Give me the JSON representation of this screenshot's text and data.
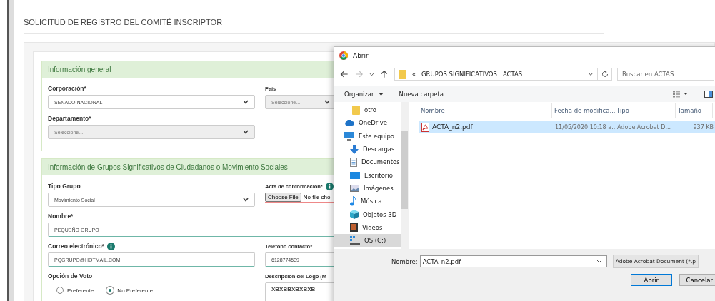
{
  "page": {
    "title": "SOLICITUD DE REGISTRO DEL COMITÉ INSCRIPTOR"
  },
  "sections": [
    {
      "title": "Información general",
      "rows": [
        [
          {
            "kind": "select",
            "label": "Corporación*",
            "value": "SENADO NACIONAL",
            "disabled": false
          },
          {
            "kind": "select",
            "label": "País",
            "placeholder": "Seleccione...",
            "disabled": true
          }
        ],
        [
          {
            "kind": "select",
            "label": "Departamento*",
            "placeholder": "Seleccione...",
            "disabled": true
          }
        ]
      ]
    },
    {
      "title": "Información de Grupos Significativos de Ciudadanos o Movimiento Sociales",
      "rows": [
        [
          {
            "kind": "select",
            "label": "Tipo Grupo",
            "value": "Movimiento Social",
            "disabled": false
          },
          {
            "kind": "file",
            "label": "Acta de conformación*",
            "info": true,
            "button": "Choose File",
            "status": "No file cho"
          }
        ],
        [
          {
            "kind": "wide-text",
            "label": "Nombre*",
            "value": "PEQUEÑO GRUPO"
          }
        ],
        [
          {
            "kind": "text",
            "label": "Correo electrónico*",
            "info": true,
            "value": "PQGRUPO@HOTMAIL.COM"
          },
          {
            "kind": "text",
            "label": "Teléfono contacto*",
            "value": "6128774539"
          }
        ],
        [
          {
            "kind": "radio",
            "label": "Opción de Voto",
            "options": [
              {
                "label": "Preferente",
                "selected": false
              },
              {
                "label": "No Preferente",
                "selected": true
              }
            ]
          },
          {
            "kind": "textarea",
            "label": "Descripción del Logo (M",
            "value": "XBXBBXBXBXB"
          }
        ]
      ]
    }
  ],
  "dialog": {
    "title": "Abrir",
    "path": [
      "«",
      "GRUPOS SIGNIFICATIVOS",
      "ACTAS"
    ],
    "search": {
      "placeholder": "Buscar en ACTAS"
    },
    "toolbar": [
      {
        "label": "Organizar",
        "dropdown": true
      },
      {
        "label": "Nueva carpeta",
        "dropdown": false
      }
    ],
    "nav": [
      {
        "label": "otro",
        "selected": false
      },
      {
        "label": "OneDrive",
        "selected": false
      },
      {
        "label": "Este equipo",
        "selected": false,
        "children": [
          {
            "label": "Descargas",
            "selected": false
          },
          {
            "label": "Documentos",
            "selected": false
          },
          {
            "label": "Escritorio",
            "selected": false
          },
          {
            "label": "Imágenes",
            "selected": false
          },
          {
            "label": "Música",
            "selected": false
          },
          {
            "label": "Objetos 3D",
            "selected": false
          },
          {
            "label": "Vídeos",
            "selected": false
          },
          {
            "label": "OS (C:)",
            "selected": true
          }
        ]
      }
    ],
    "columns": [
      "Nombre",
      "Fecha de modifica...",
      "Tipo",
      "Tamaño"
    ],
    "files": [
      {
        "name": "ACTA_n2.pdf",
        "modified": "11/05/2020 10:18 a...",
        "type": "Adobe Acrobat D...",
        "size": "937 KB",
        "selected": true
      }
    ],
    "filename": {
      "label": "Nombre:",
      "value": "ACTA_n2.pdf"
    },
    "filetype": "Adobe Acrobat Document (*.p",
    "buttons": [
      "Abrir",
      "Cancelar"
    ]
  }
}
